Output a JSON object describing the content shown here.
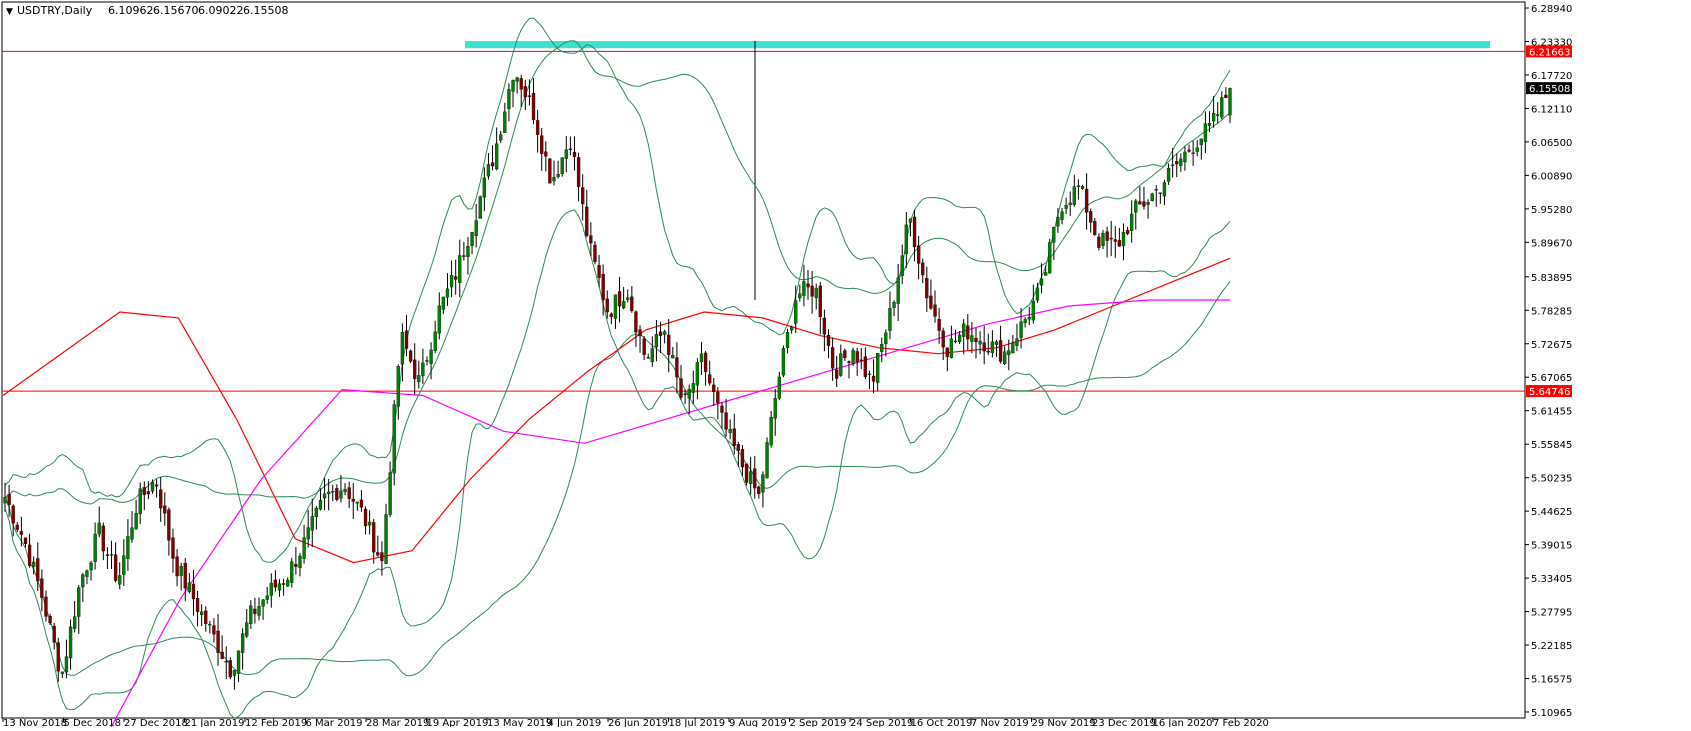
{
  "header": {
    "symbol": "USDTRY,Daily",
    "open": "6.10962",
    "high": "6.15670",
    "low": "6.09022",
    "close": "6.15508"
  },
  "chart_data": {
    "type": "candlestick",
    "ylim": [
      5.10965,
      6.2894
    ],
    "y_ticks": [
      "6.28940",
      "6.23330",
      "6.17720",
      "6.12110",
      "6.06500",
      "6.00890",
      "5.95280",
      "5.89670",
      "5.83895",
      "5.78285",
      "5.72675",
      "5.67065",
      "5.61455",
      "5.55845",
      "5.50235",
      "5.44625",
      "5.39015",
      "5.33405",
      "5.27795",
      "5.22185",
      "5.16575",
      "5.10965"
    ],
    "x_labels": [
      "13 Nov 2018",
      "5 Dec 2018",
      "27 Dec 2018",
      "21 Jan 2019",
      "12 Feb 2019",
      "6 Mar 2019",
      "28 Mar 2019",
      "19 Apr 2019",
      "13 May 2019",
      "4 Jun 2019",
      "26 Jun 2019",
      "18 Jul 2019",
      "9 Aug 2019",
      "2 Sep 2019",
      "24 Sep 2019",
      "16 Oct 2019",
      "7 Nov 2019",
      "29 Nov 2019",
      "23 Dec 2019",
      "16 Jan 2020",
      "7 Feb 2020"
    ],
    "levels": [
      {
        "label": "6.21663",
        "value": 6.21663,
        "color": "#ff0000"
      },
      {
        "label": "5.64746",
        "value": 5.64746,
        "color": "#ff0000"
      }
    ],
    "current_price": {
      "label": "6.15508",
      "value": 6.15508
    },
    "zone": {
      "low": 6.222,
      "high": 6.234,
      "color": "#40e0d0"
    },
    "colors": {
      "bull": "#008000",
      "bear": "#800000",
      "wick": "#000000",
      "bands": "#2e8b57",
      "ma_red": "#ff0000",
      "ma_magenta": "#ff00ff"
    },
    "key_closes": [
      5.47,
      5.4,
      5.3,
      5.17,
      5.33,
      5.41,
      5.33,
      5.46,
      5.5,
      5.36,
      5.3,
      5.24,
      5.18,
      5.27,
      5.31,
      5.34,
      5.4,
      5.47,
      5.49,
      5.44,
      5.36,
      5.74,
      5.66,
      5.78,
      5.85,
      5.95,
      6.05,
      6.19,
      6.12,
      6.0,
      6.07,
      5.89,
      5.78,
      5.82,
      5.7,
      5.75,
      5.62,
      5.7,
      5.6,
      5.53,
      5.47,
      5.66,
      5.81,
      5.82,
      5.68,
      5.72,
      5.66,
      5.78,
      5.94,
      5.8,
      5.72,
      5.75,
      5.73,
      5.71,
      5.76,
      5.82,
      5.96,
      5.99,
      5.9,
      5.89,
      5.95,
      5.98,
      6.02,
      6.06,
      6.09,
      6.155
    ],
    "ma_red_key": [
      5.64,
      5.71,
      5.78,
      5.77,
      5.6,
      5.4,
      5.36,
      5.38,
      5.5,
      5.6,
      5.68,
      5.75,
      5.78,
      5.77,
      5.74,
      5.72,
      5.71,
      5.72,
      5.75,
      5.79,
      5.83,
      5.87
    ],
    "ma_magenta_key": [
      5.05,
      5.3,
      5.5,
      5.65,
      5.64,
      5.58,
      5.56,
      5.6,
      5.64,
      5.68,
      5.72,
      5.76,
      5.79,
      5.8,
      5.8
    ],
    "notes": []
  }
}
